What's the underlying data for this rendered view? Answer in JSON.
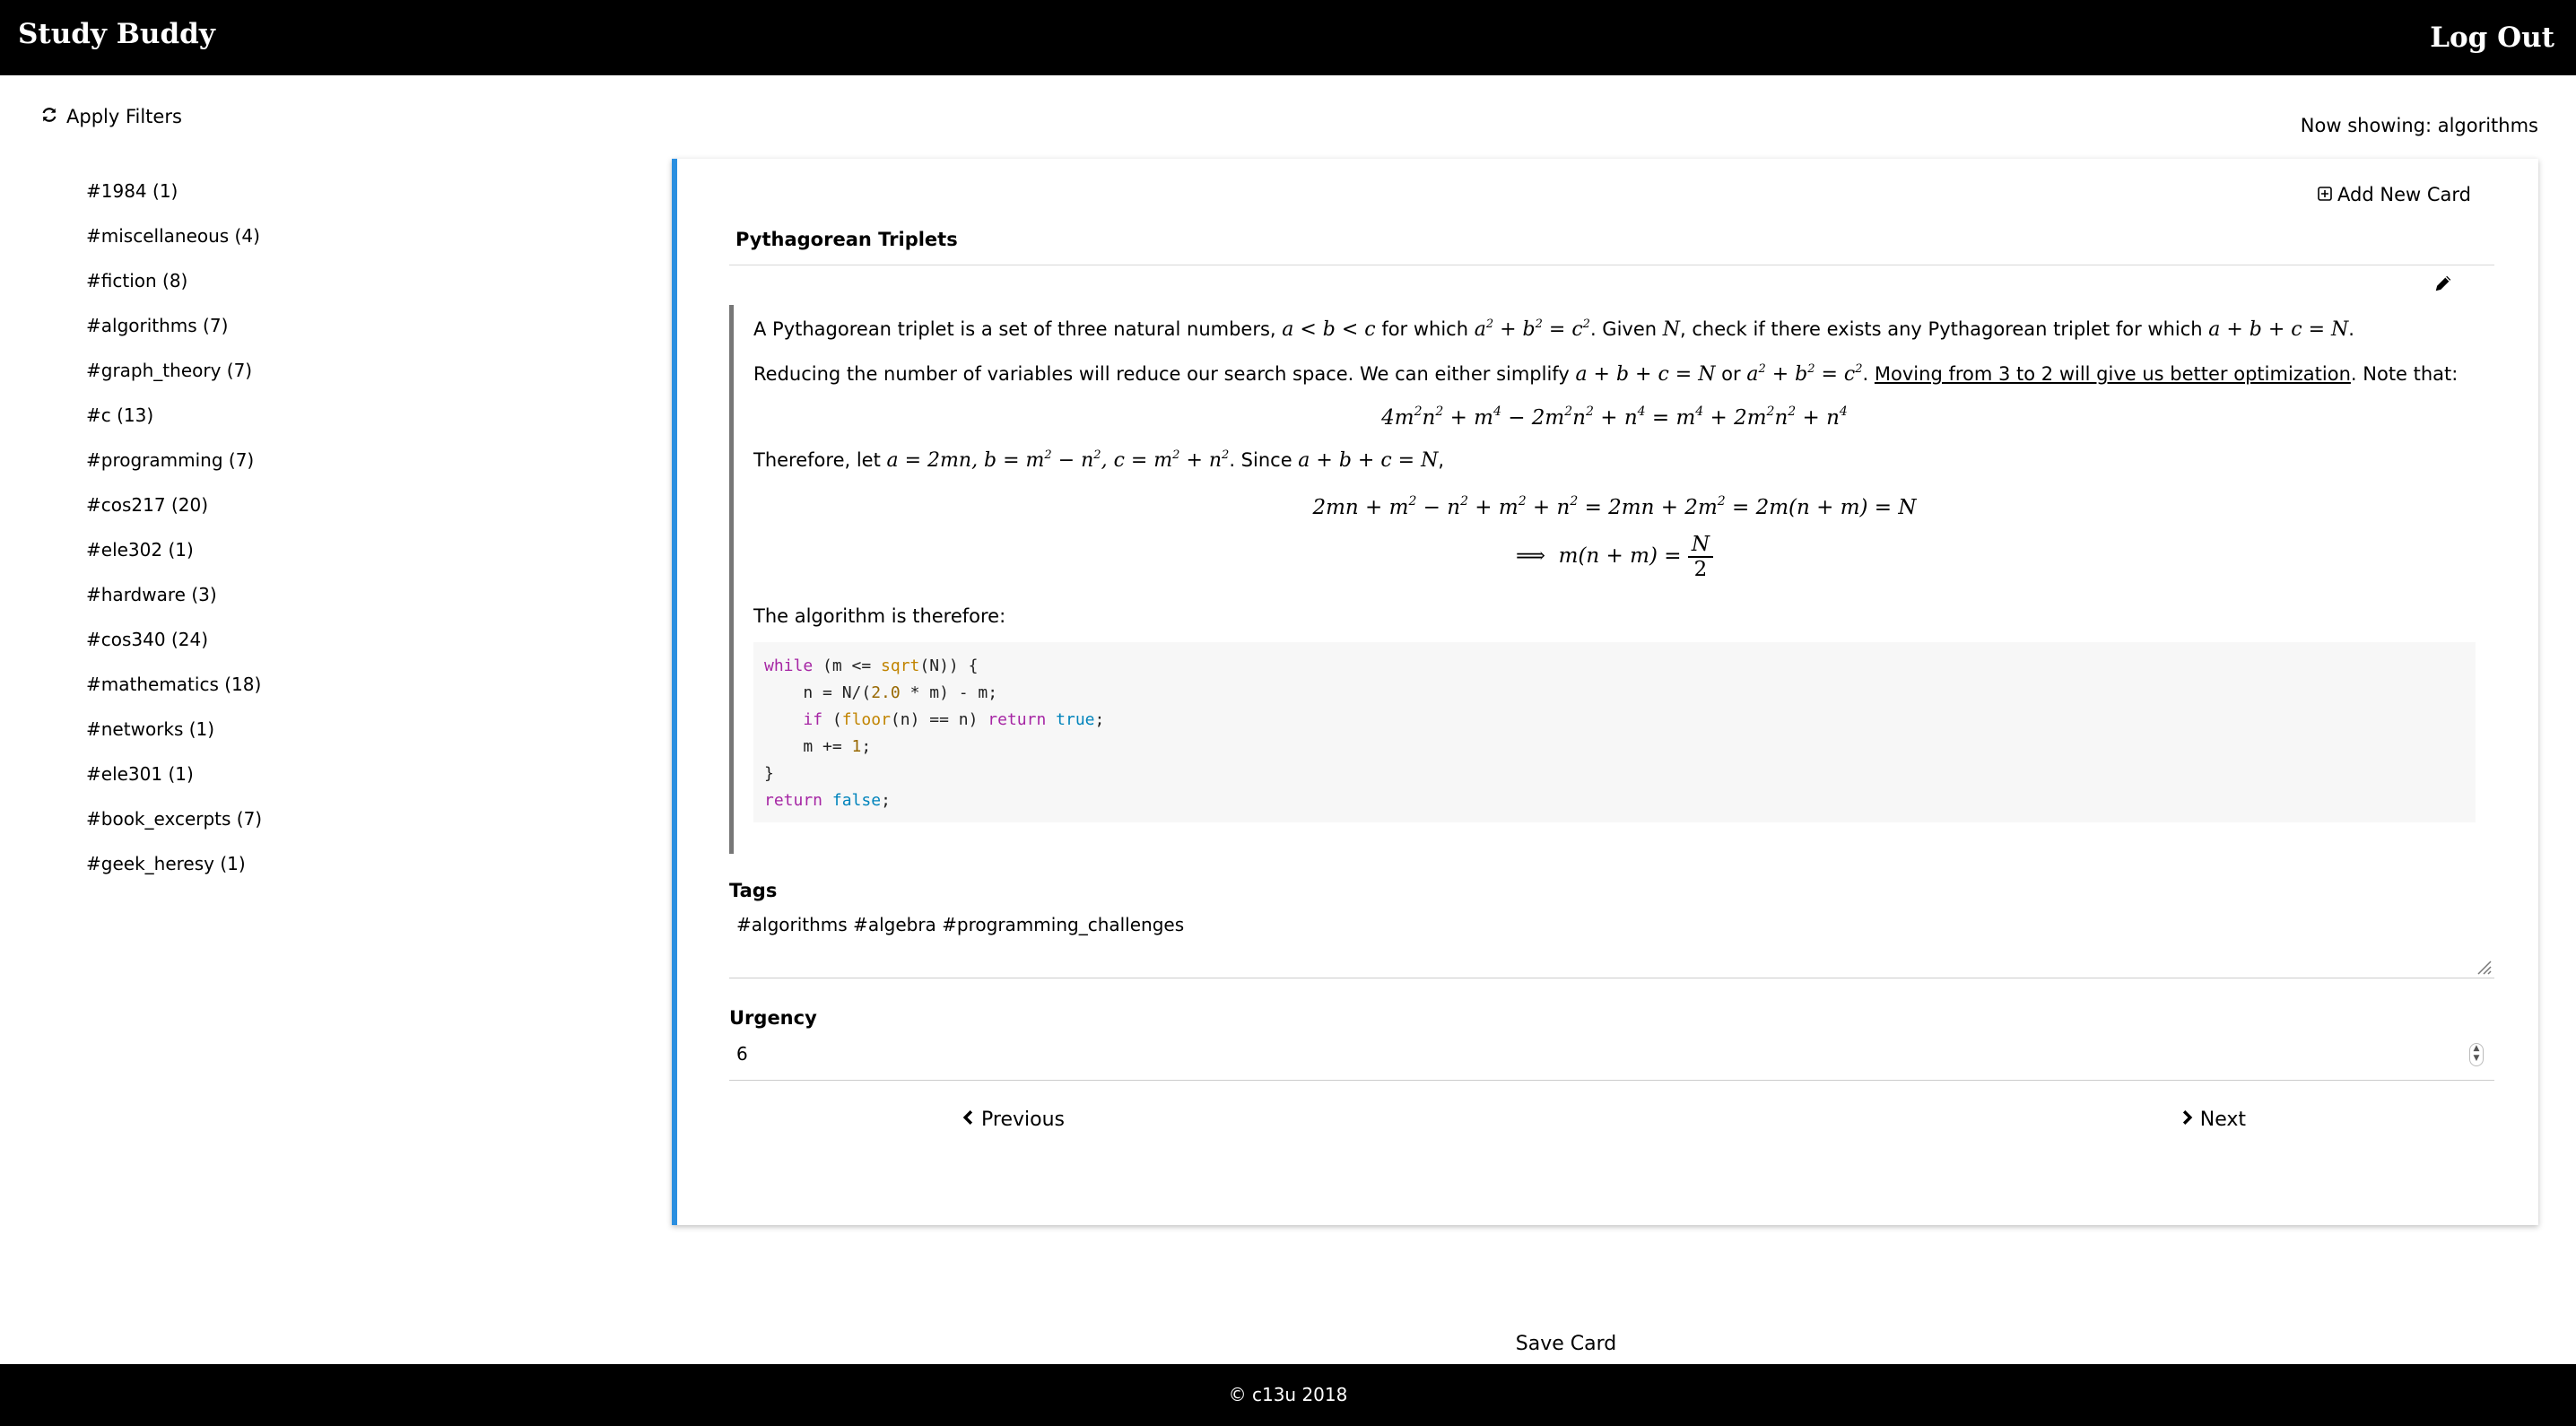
{
  "header": {
    "brand": "Study Buddy",
    "logout": "Log Out"
  },
  "sidebar": {
    "apply_filters": "Apply Filters",
    "tags": [
      "#1984 (1)",
      "#miscellaneous (4)",
      "#fiction (8)",
      "#algorithms (7)",
      "#graph_theory (7)",
      "#c (13)",
      "#programming (7)",
      "#cos217 (20)",
      "#ele302 (1)",
      "#hardware (3)",
      "#cos340 (24)",
      "#mathematics (18)",
      "#networks (1)",
      "#ele301 (1)",
      "#book_excerpts (7)",
      "#geek_heresy (1)"
    ]
  },
  "main": {
    "now_showing": "Now showing: algorithms",
    "add_card": "Add New Card",
    "card": {
      "title": "Pythagorean Triplets",
      "para1": {
        "a": "A Pythagorean triplet is a set of three natural numbers, ",
        "b": " for which ",
        "c": ". Given ",
        "d": ", check if there exists any Pythagorean triplet for which ",
        "e": "."
      },
      "para2": {
        "a": "Reducing the number of variables will reduce our search space. We can either simplify ",
        "b": " or ",
        "c": ". ",
        "link": "Moving from 3 to 2 will give us better optimization",
        "d": ". Note that:"
      },
      "para3": {
        "a": "Therefore, let ",
        "b": ". Since ",
        "c": ","
      },
      "para4": "The algorithm is therefore:",
      "code": {
        "line1": {
          "kw": "while",
          "a": " (m <= ",
          "fn": "sqrt",
          "b": "(N)) {"
        },
        "line2": {
          "a": "    n = N/(",
          "num": "2.0",
          "b": " * m) - m;"
        },
        "line3": {
          "kw": "if",
          "a": " (",
          "fn": "floor",
          "b": "(n) == n) ",
          "kw2": "return",
          "c": " ",
          "bool": "true",
          "d": ";"
        },
        "line4": {
          "a": "    m += ",
          "num": "1",
          "b": ";"
        },
        "line5": "}",
        "line6": {
          "kw": "return",
          "a": " ",
          "bool": "false",
          "b": ";"
        }
      }
    },
    "tags_label": "Tags",
    "tags_value": "#algorithms #algebra #programming_challenges",
    "urgency_label": "Urgency",
    "urgency_value": "6",
    "prev": "Previous",
    "next": "Next",
    "save": "Save Card"
  },
  "footer": {
    "text": "© c13u 2018"
  }
}
